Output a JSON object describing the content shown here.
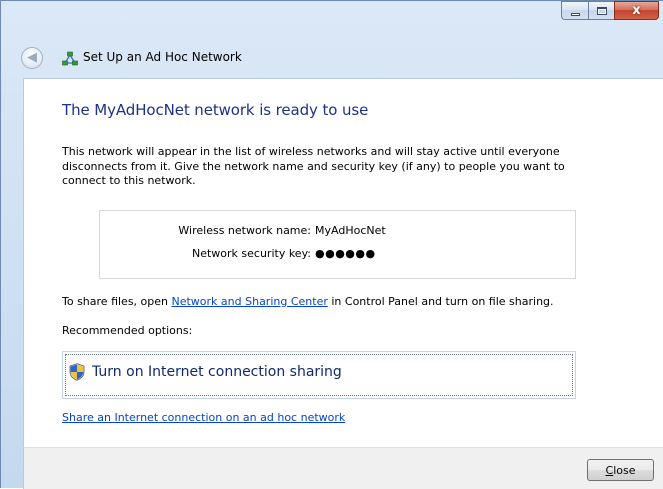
{
  "window": {
    "title": "Set Up an Ad Hoc Network",
    "caption_close_glyph": "x"
  },
  "content": {
    "heading": "The MyAdHocNet network is ready to use",
    "description": "This network will appear in the list of wireless networks and will stay active until everyone disconnects from it. Give the network name and security key (if any) to people you want to connect to this network.",
    "info": {
      "name_label": "Wireless network name:",
      "name_value": "MyAdHocNet",
      "key_label": "Network security key:",
      "key_value": "●●●●●●"
    },
    "share": {
      "prefix": "To share files, open ",
      "link": "Network and Sharing Center",
      "suffix": " in Control Panel and turn on file sharing."
    },
    "recommended_label": "Recommended options:",
    "command_link_label": "Turn on Internet connection sharing",
    "bottom_link": "Share an Internet connection on an ad hoc network"
  },
  "footer": {
    "close_label_underlined": "C",
    "close_label_rest": "lose"
  },
  "colors": {
    "heading": "#1e3287",
    "link": "#0645cc",
    "chrome": "#cddff3"
  }
}
